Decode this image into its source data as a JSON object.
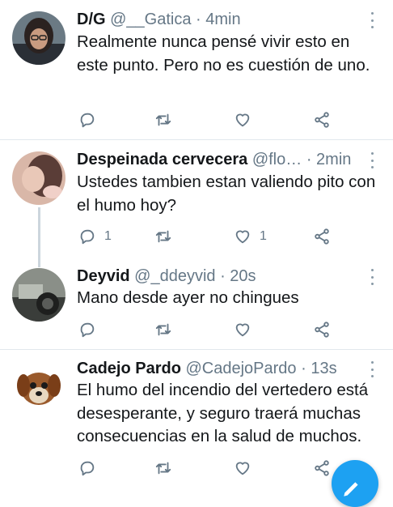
{
  "tweets": [
    {
      "name": "D/G",
      "handle": "@__Gatica",
      "time": "· 4min",
      "text": "Realmente nunca pensé vivir esto en este punto. Pero no es cuestión de uno.",
      "retweets": "",
      "likes": ""
    },
    {
      "name": "Despeinada cervecera",
      "handle": "@flo…",
      "time": "· 2min",
      "text": "Ustedes tambien estan valiendo pito con el humo hoy?",
      "replies": "1",
      "likes": "1"
    },
    {
      "name": "Deyvid",
      "handle": "@_ddeyvid",
      "time": "· 20s",
      "text": "Mano desde ayer no chingues"
    },
    {
      "name": "Cadejo Pardo",
      "handle": "@CadejoPardo",
      "time": "· 13s",
      "text": "El humo del incendio del vertedero está desesperante, y seguro traerá muchas consecuencias en la salud de muchos."
    }
  ],
  "icons": {
    "reply": "reply-icon",
    "retweet": "retweet-icon",
    "like": "heart-icon",
    "share": "share-icon",
    "compose": "compose-icon"
  },
  "colors": {
    "accent": "#1da1f2",
    "muted": "#657786",
    "divider": "#e1e8ed"
  }
}
